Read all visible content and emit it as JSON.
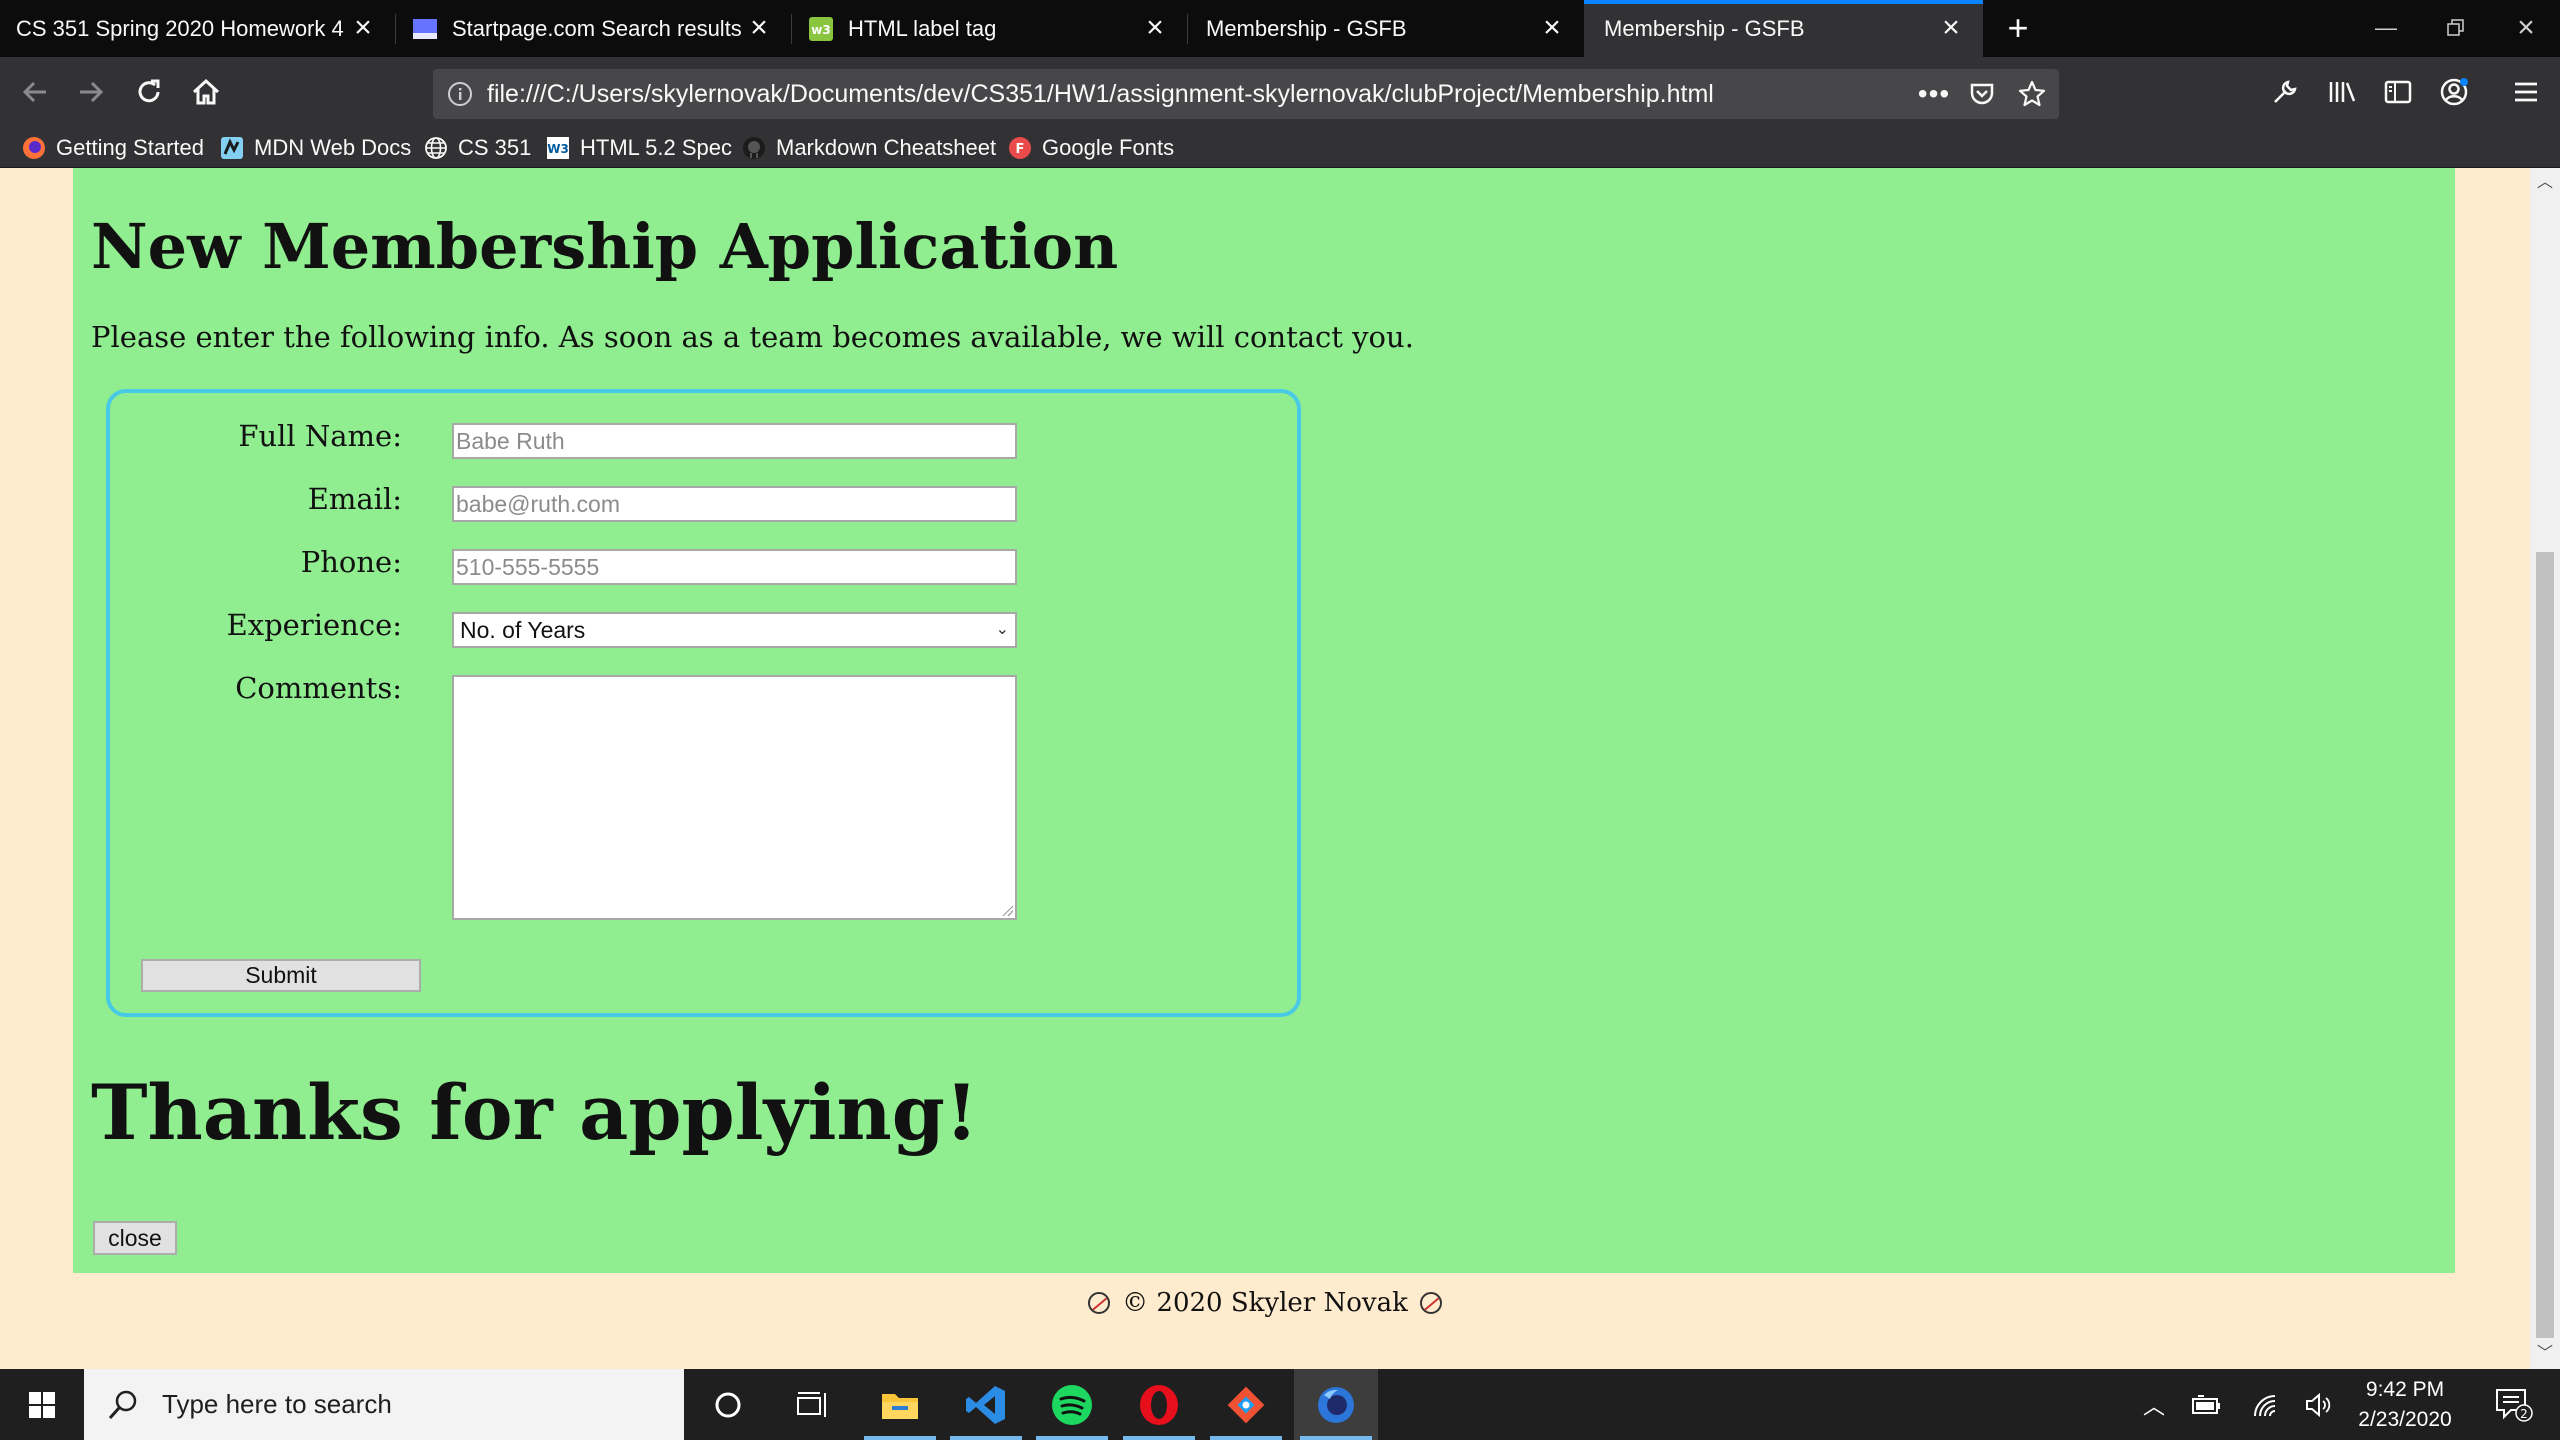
{
  "tabs": [
    {
      "title": "CS 351 Spring 2020 Homework 4",
      "active": false
    },
    {
      "title": "Startpage.com Search results",
      "active": false
    },
    {
      "title": "HTML label tag",
      "active": false
    },
    {
      "title": "Membership - GSFB",
      "active": false
    },
    {
      "title": "Membership - GSFB",
      "active": true
    }
  ],
  "nav": {
    "url": "file:///C:/Users/skylernovak/Documents/dev/CS351/HW1/assignment-skylernovak/clubProject/Membership.html"
  },
  "bookmarks": [
    {
      "label": "Getting Started",
      "icon": "firefox-icon"
    },
    {
      "label": "MDN Web Docs",
      "icon": "mdn-icon"
    },
    {
      "label": "CS 351",
      "icon": "globe-icon"
    },
    {
      "label": "HTML 5.2 Spec",
      "icon": "w3c-icon"
    },
    {
      "label": "Markdown Cheatsheet",
      "icon": "github-icon"
    },
    {
      "label": "Google Fonts",
      "icon": "google-fonts-icon"
    }
  ],
  "page": {
    "heading": "New Membership Application",
    "intro": "Please enter the following info. As soon as a team becomes available, we will contact you.",
    "form": {
      "full_name_label": "Full Name:",
      "full_name_placeholder": "Babe Ruth",
      "email_label": "Email:",
      "email_placeholder": "babe@ruth.com",
      "phone_label": "Phone:",
      "phone_placeholder": "510-555-5555",
      "experience_label": "Experience:",
      "experience_selected": "No. of Years",
      "comments_label": "Comments:",
      "submit_label": "Submit"
    },
    "thanks": "Thanks for applying!",
    "close_label": "close",
    "footer": "© 2020 Skyler Novak"
  },
  "taskbar": {
    "search_placeholder": "Type here to search",
    "time": "9:42 PM",
    "date": "2/23/2020",
    "notification_count": "2"
  },
  "colors": {
    "page_background": "#ffebcd",
    "main_background": "#90ee90",
    "form_border": "#48c9e6",
    "tab_accent": "#0a84ff"
  }
}
